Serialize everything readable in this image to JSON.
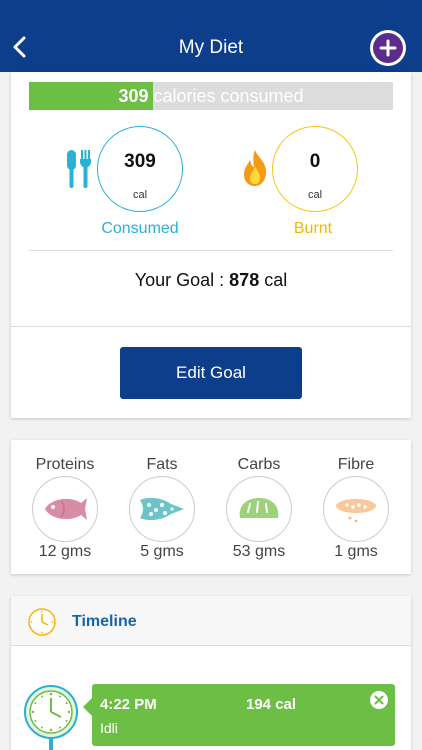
{
  "header": {
    "title": "My Diet"
  },
  "calories": {
    "consumed_value": "309",
    "consumed_suffix": " calories consumed",
    "progress_fraction": 0.34
  },
  "consumed": {
    "value": "309",
    "unit": "cal",
    "label": "Consumed",
    "icon": "fork-knife-icon"
  },
  "burnt": {
    "value": "0",
    "unit": "cal",
    "label": "Burnt",
    "icon": "flame-icon"
  },
  "goal": {
    "label": "Your Goal : ",
    "value": "878",
    "unit": " cal"
  },
  "edit_goal_label": "Edit Goal",
  "nutrients": [
    {
      "name": "Proteins",
      "value": "12 gms",
      "icon": "fish-icon"
    },
    {
      "name": "Fats",
      "value": "5 gms",
      "icon": "fat-icon"
    },
    {
      "name": "Carbs",
      "value": "53 gms",
      "icon": "bread-icon"
    },
    {
      "name": "Fibre",
      "value": "1 gms",
      "icon": "fibre-icon"
    }
  ],
  "timeline": {
    "title": "Timeline",
    "entries": [
      {
        "time": "4:22 PM",
        "calories": "194 cal",
        "name": "Idli"
      }
    ]
  },
  "colors": {
    "primary": "#0c3e8c",
    "accent_green": "#6cbe45",
    "consumed_blue": "#29b1d6",
    "burnt_yellow": "#f2b705",
    "add_purple": "#5b2c8e"
  }
}
